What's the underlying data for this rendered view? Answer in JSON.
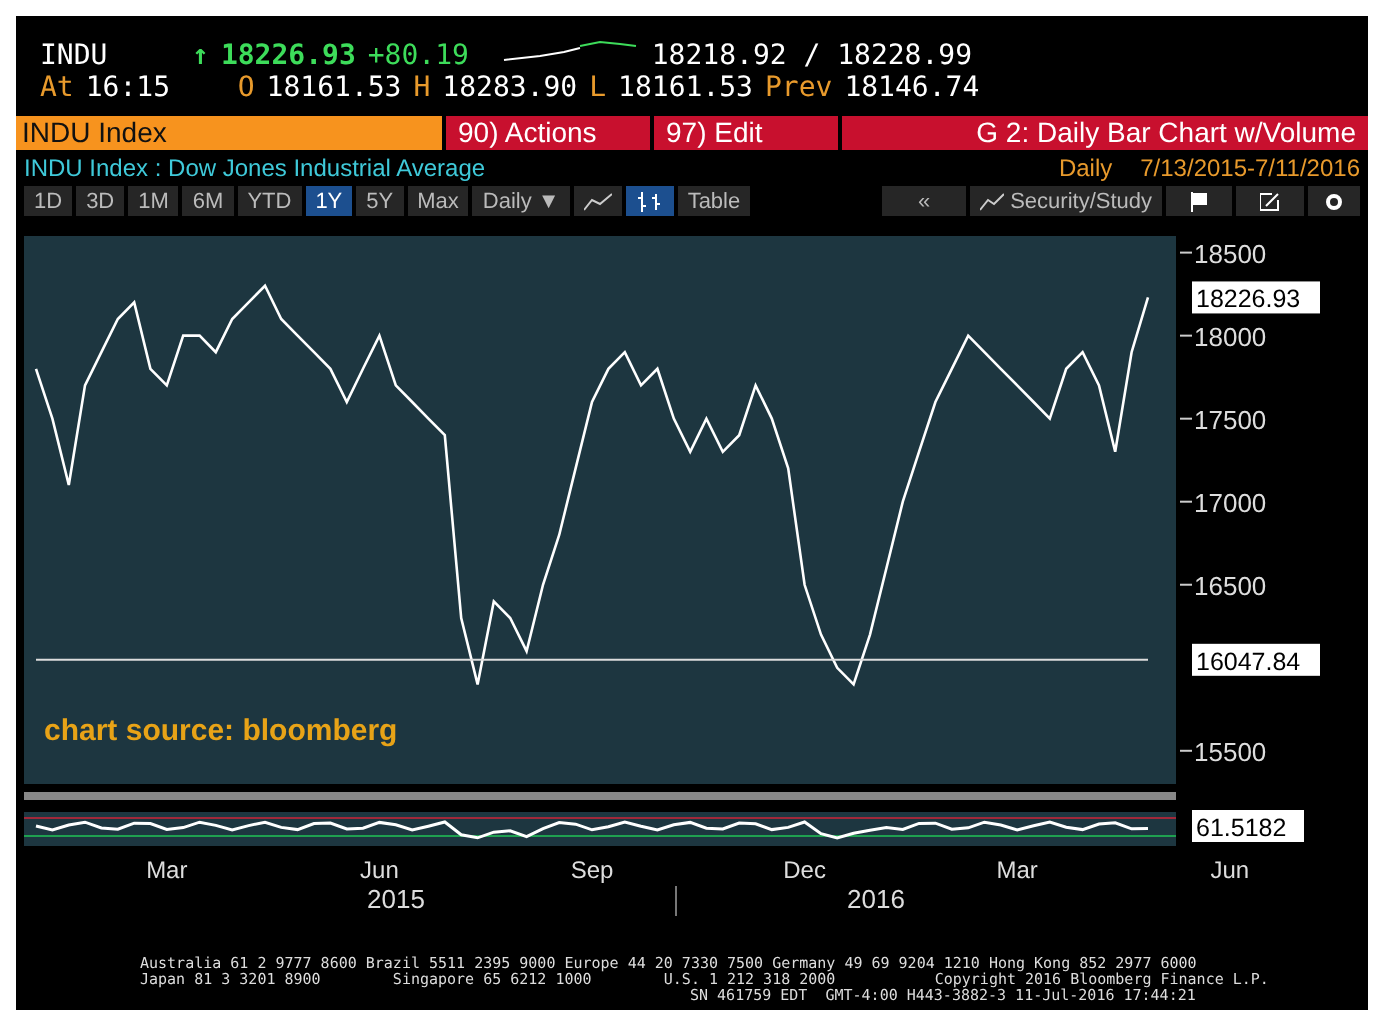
{
  "quote": {
    "ticker": "INDU",
    "arrow": "↑",
    "last": "18226.93",
    "change": "+80.19",
    "bid_ask": "18218.92 / 18228.99",
    "time_label": "At",
    "time": "16:15",
    "open_label": "O",
    "open": "18161.53",
    "high_label": "H",
    "high": "18283.90",
    "low_label": "L",
    "low": "18161.53",
    "prev_label": "Prev",
    "prev": "18146.74"
  },
  "command_bar": {
    "security": "INDU Index",
    "actions": "90) Actions",
    "edit": "97) Edit",
    "title": "G 2: Daily Bar Chart w/Volume"
  },
  "subtitle": {
    "name": "INDU Index : Dow Jones Industrial Average",
    "period": "Daily",
    "range": "7/13/2015-7/11/2016"
  },
  "periods": [
    {
      "label": "1D",
      "selected": false
    },
    {
      "label": "3D",
      "selected": false
    },
    {
      "label": "1M",
      "selected": false
    },
    {
      "label": "6M",
      "selected": false
    },
    {
      "label": "YTD",
      "selected": false
    },
    {
      "label": "1Y",
      "selected": true
    },
    {
      "label": "5Y",
      "selected": false
    },
    {
      "label": "Max",
      "selected": false
    }
  ],
  "toolbar": {
    "frequency": "Daily ▼",
    "chart_types": [
      {
        "kind": "line",
        "selected": false
      },
      {
        "kind": "bars",
        "selected": true
      }
    ],
    "table": "Table",
    "back": "«",
    "study": "Security/Study"
  },
  "chart": {
    "chart_data": {
      "type": "line",
      "ylim": [
        15300,
        18600
      ],
      "yticks": [
        15500,
        16500,
        17000,
        17500,
        18000,
        18500
      ],
      "series": [
        {
          "color": "#ffffff",
          "values": [
            17800,
            17500,
            17100,
            17700,
            17900,
            18100,
            18200,
            17800,
            17700,
            18000,
            18000,
            17900,
            18100,
            18200,
            18300,
            18100,
            18000,
            17900,
            17800,
            17600,
            17800,
            18000,
            17700,
            17600,
            17500,
            17400,
            16300,
            15900,
            16400,
            16300,
            16100,
            16500,
            16800,
            17200,
            17600,
            17800,
            17900,
            17700,
            17800,
            17500,
            17300,
            17500,
            17300,
            17400,
            17700,
            17500,
            17200,
            16500,
            16200,
            16000,
            15900,
            16200,
            16600,
            17000,
            17300,
            17600,
            17800,
            18000,
            17900,
            17800,
            17700,
            17600,
            17500,
            17800,
            17900,
            17700,
            17300,
            17900,
            18230
          ]
        },
        {
          "color": "#dddddd",
          "values": [
            16047.84,
            16047.84,
            16047.84,
            16047.84,
            16047.84,
            16047.84,
            16047.84,
            16047.84,
            16047.84,
            16047.84,
            16047.84,
            16047.84,
            16047.84,
            16047.84,
            16047.84,
            16047.84,
            16047.84,
            16047.84,
            16047.84,
            16047.84,
            16047.84,
            16047.84,
            16047.84,
            16047.84,
            16047.84,
            16047.84,
            16047.84,
            16047.84,
            16047.84,
            16047.84,
            16047.84,
            16047.84,
            16047.84,
            16047.84,
            16047.84,
            16047.84,
            16047.84,
            16047.84,
            16047.84,
            16047.84,
            16047.84,
            16047.84,
            16047.84,
            16047.84,
            16047.84,
            16047.84,
            16047.84,
            16047.84,
            16047.84,
            16047.84,
            16047.84,
            16047.84,
            16047.84,
            16047.84,
            16047.84,
            16047.84,
            16047.84,
            16047.84,
            16047.84,
            16047.84,
            16047.84,
            16047.84,
            16047.84,
            16047.84,
            16047.84,
            16047.84,
            16047.84,
            16047.84,
            16047.84
          ]
        }
      ]
    },
    "months": [
      "Mar",
      "Jun",
      "Sep",
      "Dec",
      "Mar",
      "Jun"
    ],
    "last_marker": "18226.93",
    "line_marker": "16047.84",
    "source": "chart source: bloomberg",
    "indicator_value": "61.5182",
    "years": [
      "2015",
      "2016"
    ]
  },
  "footer": [
    "Australia 61 2 9777 8600 Brazil 5511 2395 9000 Europe 44 20 7330 7500 Germany 49 69 9204 1210 Hong Kong 852 2977 6000",
    "Japan 81 3 3201 8900        Singapore 65 6212 1000        U.S. 1 212 318 2000           Copyright 2016 Bloomberg Finance L.P.",
    "SN 461759 EDT  GMT-4:00 H443-3882-3 11-Jul-2016 17:44:21"
  ]
}
